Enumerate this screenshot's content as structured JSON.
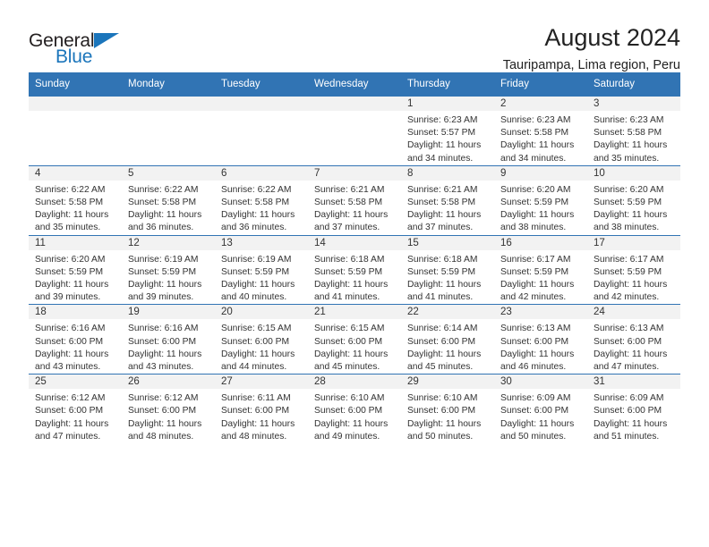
{
  "brand": {
    "name_top": "General",
    "name_bottom": "Blue",
    "triangle_icon": "triangle-icon",
    "color_dark": "#231f20",
    "color_blue": "#1b75bb"
  },
  "header": {
    "title": "August 2024",
    "subtitle": "Tauripampa, Lima region, Peru"
  },
  "theme": {
    "header_bg": "#3174b4",
    "header_text": "#ffffff",
    "daynum_bg": "#f2f2f2",
    "grid_line": "#3174b4",
    "body_text": "#333333"
  },
  "columns": [
    "Sunday",
    "Monday",
    "Tuesday",
    "Wednesday",
    "Thursday",
    "Friday",
    "Saturday"
  ],
  "weeks": [
    [
      {
        "day": "",
        "empty": true
      },
      {
        "day": "",
        "empty": true
      },
      {
        "day": "",
        "empty": true
      },
      {
        "day": "",
        "empty": true
      },
      {
        "day": "1",
        "sunrise": "Sunrise: 6:23 AM",
        "sunset": "Sunset: 5:57 PM",
        "daylight_1": "Daylight: 11 hours",
        "daylight_2": "and 34 minutes."
      },
      {
        "day": "2",
        "sunrise": "Sunrise: 6:23 AM",
        "sunset": "Sunset: 5:58 PM",
        "daylight_1": "Daylight: 11 hours",
        "daylight_2": "and 34 minutes."
      },
      {
        "day": "3",
        "sunrise": "Sunrise: 6:23 AM",
        "sunset": "Sunset: 5:58 PM",
        "daylight_1": "Daylight: 11 hours",
        "daylight_2": "and 35 minutes."
      }
    ],
    [
      {
        "day": "4",
        "sunrise": "Sunrise: 6:22 AM",
        "sunset": "Sunset: 5:58 PM",
        "daylight_1": "Daylight: 11 hours",
        "daylight_2": "and 35 minutes."
      },
      {
        "day": "5",
        "sunrise": "Sunrise: 6:22 AM",
        "sunset": "Sunset: 5:58 PM",
        "daylight_1": "Daylight: 11 hours",
        "daylight_2": "and 36 minutes."
      },
      {
        "day": "6",
        "sunrise": "Sunrise: 6:22 AM",
        "sunset": "Sunset: 5:58 PM",
        "daylight_1": "Daylight: 11 hours",
        "daylight_2": "and 36 minutes."
      },
      {
        "day": "7",
        "sunrise": "Sunrise: 6:21 AM",
        "sunset": "Sunset: 5:58 PM",
        "daylight_1": "Daylight: 11 hours",
        "daylight_2": "and 37 minutes."
      },
      {
        "day": "8",
        "sunrise": "Sunrise: 6:21 AM",
        "sunset": "Sunset: 5:58 PM",
        "daylight_1": "Daylight: 11 hours",
        "daylight_2": "and 37 minutes."
      },
      {
        "day": "9",
        "sunrise": "Sunrise: 6:20 AM",
        "sunset": "Sunset: 5:59 PM",
        "daylight_1": "Daylight: 11 hours",
        "daylight_2": "and 38 minutes."
      },
      {
        "day": "10",
        "sunrise": "Sunrise: 6:20 AM",
        "sunset": "Sunset: 5:59 PM",
        "daylight_1": "Daylight: 11 hours",
        "daylight_2": "and 38 minutes."
      }
    ],
    [
      {
        "day": "11",
        "sunrise": "Sunrise: 6:20 AM",
        "sunset": "Sunset: 5:59 PM",
        "daylight_1": "Daylight: 11 hours",
        "daylight_2": "and 39 minutes."
      },
      {
        "day": "12",
        "sunrise": "Sunrise: 6:19 AM",
        "sunset": "Sunset: 5:59 PM",
        "daylight_1": "Daylight: 11 hours",
        "daylight_2": "and 39 minutes."
      },
      {
        "day": "13",
        "sunrise": "Sunrise: 6:19 AM",
        "sunset": "Sunset: 5:59 PM",
        "daylight_1": "Daylight: 11 hours",
        "daylight_2": "and 40 minutes."
      },
      {
        "day": "14",
        "sunrise": "Sunrise: 6:18 AM",
        "sunset": "Sunset: 5:59 PM",
        "daylight_1": "Daylight: 11 hours",
        "daylight_2": "and 41 minutes."
      },
      {
        "day": "15",
        "sunrise": "Sunrise: 6:18 AM",
        "sunset": "Sunset: 5:59 PM",
        "daylight_1": "Daylight: 11 hours",
        "daylight_2": "and 41 minutes."
      },
      {
        "day": "16",
        "sunrise": "Sunrise: 6:17 AM",
        "sunset": "Sunset: 5:59 PM",
        "daylight_1": "Daylight: 11 hours",
        "daylight_2": "and 42 minutes."
      },
      {
        "day": "17",
        "sunrise": "Sunrise: 6:17 AM",
        "sunset": "Sunset: 5:59 PM",
        "daylight_1": "Daylight: 11 hours",
        "daylight_2": "and 42 minutes."
      }
    ],
    [
      {
        "day": "18",
        "sunrise": "Sunrise: 6:16 AM",
        "sunset": "Sunset: 6:00 PM",
        "daylight_1": "Daylight: 11 hours",
        "daylight_2": "and 43 minutes."
      },
      {
        "day": "19",
        "sunrise": "Sunrise: 6:16 AM",
        "sunset": "Sunset: 6:00 PM",
        "daylight_1": "Daylight: 11 hours",
        "daylight_2": "and 43 minutes."
      },
      {
        "day": "20",
        "sunrise": "Sunrise: 6:15 AM",
        "sunset": "Sunset: 6:00 PM",
        "daylight_1": "Daylight: 11 hours",
        "daylight_2": "and 44 minutes."
      },
      {
        "day": "21",
        "sunrise": "Sunrise: 6:15 AM",
        "sunset": "Sunset: 6:00 PM",
        "daylight_1": "Daylight: 11 hours",
        "daylight_2": "and 45 minutes."
      },
      {
        "day": "22",
        "sunrise": "Sunrise: 6:14 AM",
        "sunset": "Sunset: 6:00 PM",
        "daylight_1": "Daylight: 11 hours",
        "daylight_2": "and 45 minutes."
      },
      {
        "day": "23",
        "sunrise": "Sunrise: 6:13 AM",
        "sunset": "Sunset: 6:00 PM",
        "daylight_1": "Daylight: 11 hours",
        "daylight_2": "and 46 minutes."
      },
      {
        "day": "24",
        "sunrise": "Sunrise: 6:13 AM",
        "sunset": "Sunset: 6:00 PM",
        "daylight_1": "Daylight: 11 hours",
        "daylight_2": "and 47 minutes."
      }
    ],
    [
      {
        "day": "25",
        "sunrise": "Sunrise: 6:12 AM",
        "sunset": "Sunset: 6:00 PM",
        "daylight_1": "Daylight: 11 hours",
        "daylight_2": "and 47 minutes."
      },
      {
        "day": "26",
        "sunrise": "Sunrise: 6:12 AM",
        "sunset": "Sunset: 6:00 PM",
        "daylight_1": "Daylight: 11 hours",
        "daylight_2": "and 48 minutes."
      },
      {
        "day": "27",
        "sunrise": "Sunrise: 6:11 AM",
        "sunset": "Sunset: 6:00 PM",
        "daylight_1": "Daylight: 11 hours",
        "daylight_2": "and 48 minutes."
      },
      {
        "day": "28",
        "sunrise": "Sunrise: 6:10 AM",
        "sunset": "Sunset: 6:00 PM",
        "daylight_1": "Daylight: 11 hours",
        "daylight_2": "and 49 minutes."
      },
      {
        "day": "29",
        "sunrise": "Sunrise: 6:10 AM",
        "sunset": "Sunset: 6:00 PM",
        "daylight_1": "Daylight: 11 hours",
        "daylight_2": "and 50 minutes."
      },
      {
        "day": "30",
        "sunrise": "Sunrise: 6:09 AM",
        "sunset": "Sunset: 6:00 PM",
        "daylight_1": "Daylight: 11 hours",
        "daylight_2": "and 50 minutes."
      },
      {
        "day": "31",
        "sunrise": "Sunrise: 6:09 AM",
        "sunset": "Sunset: 6:00 PM",
        "daylight_1": "Daylight: 11 hours",
        "daylight_2": "and 51 minutes."
      }
    ]
  ]
}
